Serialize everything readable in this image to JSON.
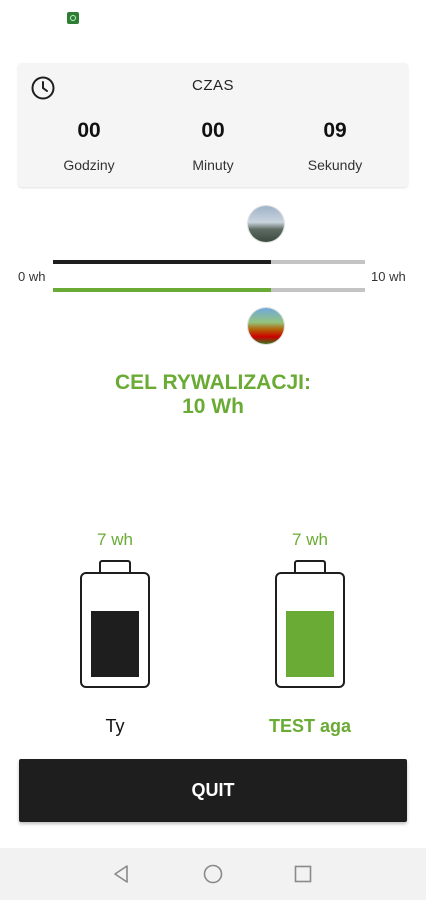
{
  "status_bar": {
    "icon": "app-notification-icon"
  },
  "timer": {
    "title": "CZAS",
    "icon": "clock-icon",
    "hours": {
      "value": "00",
      "label": "Godziny"
    },
    "minutes": {
      "value": "00",
      "label": "Minuty"
    },
    "seconds": {
      "value": "09",
      "label": "Sekundy"
    }
  },
  "progress": {
    "min_label": "0 wh",
    "max_label": "10 wh",
    "you_fraction": 0.7,
    "opponent_fraction": 0.7
  },
  "goal": {
    "line1": "CEL RYWALIZACJI:",
    "line2": "10 Wh"
  },
  "players": {
    "you": {
      "value_label": "7 wh",
      "name": "Ty",
      "level_fraction": 0.7
    },
    "opponent": {
      "value_label": "7 wh",
      "name": "TEST aga",
      "level_fraction": 0.7
    }
  },
  "actions": {
    "quit_label": "QUIT"
  },
  "colors": {
    "accent": "#6aab35",
    "dark": "#1e1e1e",
    "track": "#c4c4c4"
  },
  "nav": {
    "back_icon": "back-triangle-icon",
    "home_icon": "home-circle-icon",
    "recents_icon": "recents-square-icon"
  }
}
